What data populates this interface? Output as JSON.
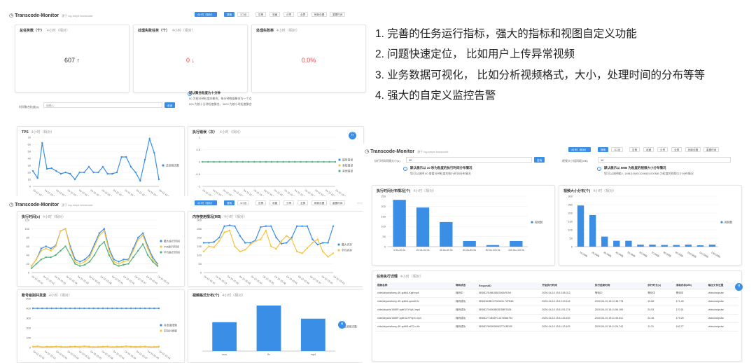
{
  "left": {
    "header": {
      "title": "Transcode-Monitor",
      "subtitle": "源于 log-smpe-transcode",
      "buttons": [
        "4小时（相对）",
        "搜索",
        "1口设",
        "告警",
        "收藏",
        "分享",
        "全屏",
        "刷新设置",
        "重置时间"
      ]
    },
    "stats": [
      {
        "title": "总任务数（个）",
        "time": "4小时（相对）",
        "value": "607 ↑"
      },
      {
        "title": "处理失败任务（个）",
        "time": "4小时（相对）",
        "value": "0 ↓"
      },
      {
        "title": "处理失败率",
        "time": "4小时（相对）",
        "value": "0.0%"
      }
    ],
    "agg": {
      "label": "时间聚合粒度(s)",
      "placeholder": "请输入",
      "search": "查询",
      "info_title": "默认聚合粒度为十分钟",
      "info_line1": "60 为按分钟粒度的聚合，每分钟数据聚合为一个点",
      "info_line2": "600 为按十分钟粒度聚合，3600 为按小时粒度聚合"
    },
    "tps": {
      "title": "TPS",
      "time": "4小时（相对）",
      "legend": "总调用次数"
    },
    "err": {
      "title": "执行错误（次）",
      "time": "4小时（相对）",
      "legend": [
        "超时错误",
        "系统错误",
        "其他错误"
      ]
    },
    "header2": {
      "title": "Transcode-Monitor",
      "subtitle": "源于 log-smpe-transcode",
      "buttons": [
        "4小时（相对）",
        "搜索",
        "1口设",
        "告警",
        "收藏",
        "分享",
        "全屏",
        "刷新设置",
        "重置时间"
      ]
    },
    "exec_time": {
      "title": "执行时间(s)",
      "time": "4小时（相对）",
      "legend": [
        "最大执行时间",
        "P95执行时间",
        "平均执行时间"
      ]
    },
    "memory": {
      "title": "内存使用情况(MB)",
      "time": "4小时（相对）",
      "legend": [
        "最大内存",
        "平均内存"
      ]
    },
    "concurrency": {
      "title": "账号级别并发度",
      "time": "4小时（相对）",
      "legend": [
        "并发度限制",
        "实际并发度"
      ]
    },
    "format": {
      "title": "视频格式分布(个)",
      "time": "4小时（相对）",
      "legend": "总调用次数"
    }
  },
  "bullets": [
    "1.  完善的任务运行指标，强大的指标和视图自定义功能",
    "2.  问题快速定位，  比如用户上传异常视频",
    "3.  业务数据可视化，  比如分析视频格式，大小，处理时间的分布等等",
    "4.  强大的自定义监控告警"
  ],
  "right": {
    "header": {
      "title": "Transcode-Monitor",
      "subtitle": "源于 log-smpe-transcode",
      "buttons": [
        "4小时（相对）",
        "搜索",
        "1口设",
        "告警",
        "收藏",
        "分享",
        "全屏",
        "刷新设置",
        "重置时间"
      ]
    },
    "filter1": {
      "label": "执行时间间隔大小(s)",
      "value": "20",
      "search": "查询",
      "info_title": "默认展示以 10 秒为粒度的执行时间分布情况",
      "info_line": "您可以选择 60 查看分钟粒度的执行时间分布情况"
    },
    "filter2": {
      "label": "视频大小组间距(MB)",
      "value": "10",
      "info_title": "默认展示以 5MB 为粒度的视频大小分布情况",
      "info_line": "您可以选择输入 1MB/10MB/100MB/1000MB 为粒度的视频大小分布情况"
    },
    "exec_dist": {
      "title": "执行时间分布情况(个)",
      "time": "4小时（相对）",
      "legend": "视频数"
    },
    "size_dist": {
      "title": "视频大小分布(个)",
      "time": "4小时（相对）",
      "legend": "视频数"
    },
    "table": {
      "title": "任务执行详情",
      "time": "4小时（相对）",
      "headers": [
        "视频名称",
        "转码状态",
        "RequestID",
        "开始执行时间",
        "执行结束时间",
        "执行时长(s)",
        "消耗内存(MB)",
        "输出文件位置"
      ],
      "rows": [
        [
          "video/inputs/tomy-4K-split/4-Kgif.mp4",
          "转码中",
          "5E60D7EAB15B0305AFEA0",
          "2020-04-10 15:13:55.312",
          "等待中",
          "等待中",
          "等待中",
          "video/outputs/"
        ],
        [
          "video/inputs/tomy-4K-split/4-qced0.flv",
          "转码成功",
          "5E60D61BC27023431 72FB46",
          "2020-04-10 15:12:23.116",
          "2020-04-10 15:12:36.778",
          "13.66",
          "171.48",
          "video/outputs/"
        ],
        [
          "video/inputs/1080P-split/1VYVpU.mp4",
          "转码成功",
          "5E60D734363B03E5BF2026",
          "2020-04-10 15:11:51.274",
          "2020-04-10 15:11:56.190",
          "24.93",
          "170.51",
          "video/outputs/"
        ],
        [
          "video/inputs/1080P-split/1LSPVpS.mp4",
          "转码成功",
          "5E60D771B93FC1373566794",
          "2020-04-10 15:11:25.152",
          "2020-04-10 15:11:49.612",
          "24.46",
          "179.28",
          "video/outputs/"
        ],
        [
          "video/inputs/tomy-4K-split/5-aFCLx.flv",
          "转码成功",
          "5E60D76936360637711BD35",
          "2020-04-10 15:11:13.429",
          "2020-04-10 15:11:26.743",
          "11.31",
          "162.77",
          "video/outputs/"
        ]
      ]
    }
  },
  "chart_data": [
    {
      "type": "line",
      "title": "TPS",
      "ylim": [
        0,
        70
      ],
      "yticks": [
        0,
        10,
        20,
        30,
        40,
        50,
        60,
        70
      ],
      "series": [
        {
          "name": "总调用次数",
          "values": [
            22,
            12,
            62,
            25,
            26,
            22,
            18,
            20,
            18,
            10,
            20,
            20,
            28,
            20,
            20,
            28,
            18,
            18,
            20,
            42,
            42,
            28,
            20,
            8,
            38,
            68,
            48,
            10
          ]
        }
      ]
    },
    {
      "type": "line",
      "title": "执行错误（次）",
      "ylim": [
        -1,
        1
      ],
      "yticks": [
        -1,
        -0.5,
        0,
        0.5,
        1
      ],
      "series": [
        {
          "name": "超时错误",
          "values": [
            0,
            0,
            0,
            0,
            0,
            0,
            0,
            0,
            0,
            0,
            0,
            0,
            0,
            0,
            0,
            0,
            0,
            0,
            0,
            0,
            0,
            0,
            0,
            0
          ]
        }
      ]
    },
    {
      "type": "line",
      "title": "执行时间(s)",
      "ylim": [
        0,
        120
      ],
      "yticks": [
        0,
        20,
        40,
        60,
        80,
        100,
        120
      ],
      "series": [
        {
          "name": "最大执行时间",
          "values": [
            15,
            30,
            55,
            60,
            55,
            62,
            95,
            100,
            60,
            30,
            25,
            30,
            40,
            65,
            90,
            100,
            55,
            30,
            25,
            30,
            30,
            55,
            80,
            90,
            60,
            35,
            20
          ]
        },
        {
          "name": "P95执行时间",
          "values": [
            15,
            30,
            50,
            55,
            50,
            60,
            95,
            100,
            55,
            25,
            20,
            25,
            35,
            60,
            85,
            95,
            50,
            25,
            20,
            25,
            28,
            50,
            75,
            85,
            55,
            30,
            18
          ]
        },
        {
          "name": "平均执行时间",
          "values": [
            10,
            20,
            30,
            35,
            35,
            40,
            50,
            60,
            40,
            20,
            15,
            18,
            25,
            40,
            60,
            70,
            40,
            20,
            15,
            18,
            20,
            35,
            50,
            65,
            40,
            25,
            15
          ]
        }
      ]
    },
    {
      "type": "line",
      "title": "内存使用情况(MB)",
      "ylim": [
        0,
        300
      ],
      "yticks": [
        0,
        50,
        100,
        150,
        200,
        250,
        300
      ],
      "series": [
        {
          "name": "最大内存",
          "values": [
            170,
            170,
            175,
            200,
            265,
            270,
            265,
            210,
            170,
            170,
            185,
            260,
            265,
            265,
            200,
            165,
            170,
            200,
            265,
            265,
            265,
            190,
            160,
            170,
            170,
            265
          ]
        },
        {
          "name": "平均内存",
          "values": [
            120,
            150,
            145,
            180,
            230,
            240,
            150,
            120,
            130,
            160,
            180,
            190,
            240,
            150,
            135,
            180,
            210,
            190,
            120,
            110,
            140,
            170,
            190,
            120,
            90,
            110
          ]
        }
      ]
    },
    {
      "type": "line",
      "title": "账号级别并发度",
      "ylim": [
        0,
        500
      ],
      "yticks": [
        0,
        100,
        200,
        300,
        400,
        500
      ],
      "series": [
        {
          "name": "并发度限制",
          "values": [
            400,
            400,
            400,
            400,
            400,
            400,
            400,
            400,
            400,
            400,
            400,
            400,
            400,
            400,
            400,
            400,
            400,
            400,
            400,
            400,
            400,
            400,
            400,
            400,
            400,
            400,
            400,
            400
          ]
        },
        {
          "name": "实际并发度",
          "values": [
            10,
            15,
            5,
            10,
            8,
            12,
            10,
            6,
            10,
            12,
            8,
            15,
            10,
            6,
            8,
            10,
            12,
            6,
            10,
            8,
            15,
            10,
            8,
            10,
            12,
            6,
            8,
            10
          ]
        }
      ]
    },
    {
      "type": "bar",
      "title": "视频格式分布(个)",
      "categories": [
        "mov",
        "flv",
        "mp4"
      ],
      "values": [
        165,
        260,
        185
      ],
      "ylim": [
        0,
        300
      ]
    },
    {
      "type": "bar",
      "title": "执行时间分布情况(个)",
      "categories": [
        "0.0s-20.0s",
        "20.0s-40.0s",
        "40.0s-60.0s",
        "60.0s-80.0s",
        "80.0s-100.0s",
        "100.0s-120.0s"
      ],
      "values": [
        232,
        194,
        122,
        28,
        8,
        28
      ],
      "ylim": [
        0,
        250
      ],
      "yticks": [
        0,
        50,
        100,
        150,
        200,
        250
      ]
    },
    {
      "type": "bar",
      "title": "视频大小分布(个)",
      "categories": [
        "10.0MB",
        "20.0MB",
        "30.0MB",
        "40.0MB",
        "50.0MB",
        "60.0MB",
        "70.0MB",
        "80.0MB",
        "90.0MB",
        "100.0MB",
        "120.0MB",
        "130.0MB"
      ],
      "values": [
        245,
        188,
        60,
        35,
        35,
        12,
        12,
        10,
        10,
        12,
        8,
        12
      ],
      "ylim": [
        0,
        300
      ],
      "yticks": [
        0,
        50,
        100,
        150,
        200,
        250,
        300
      ]
    }
  ]
}
